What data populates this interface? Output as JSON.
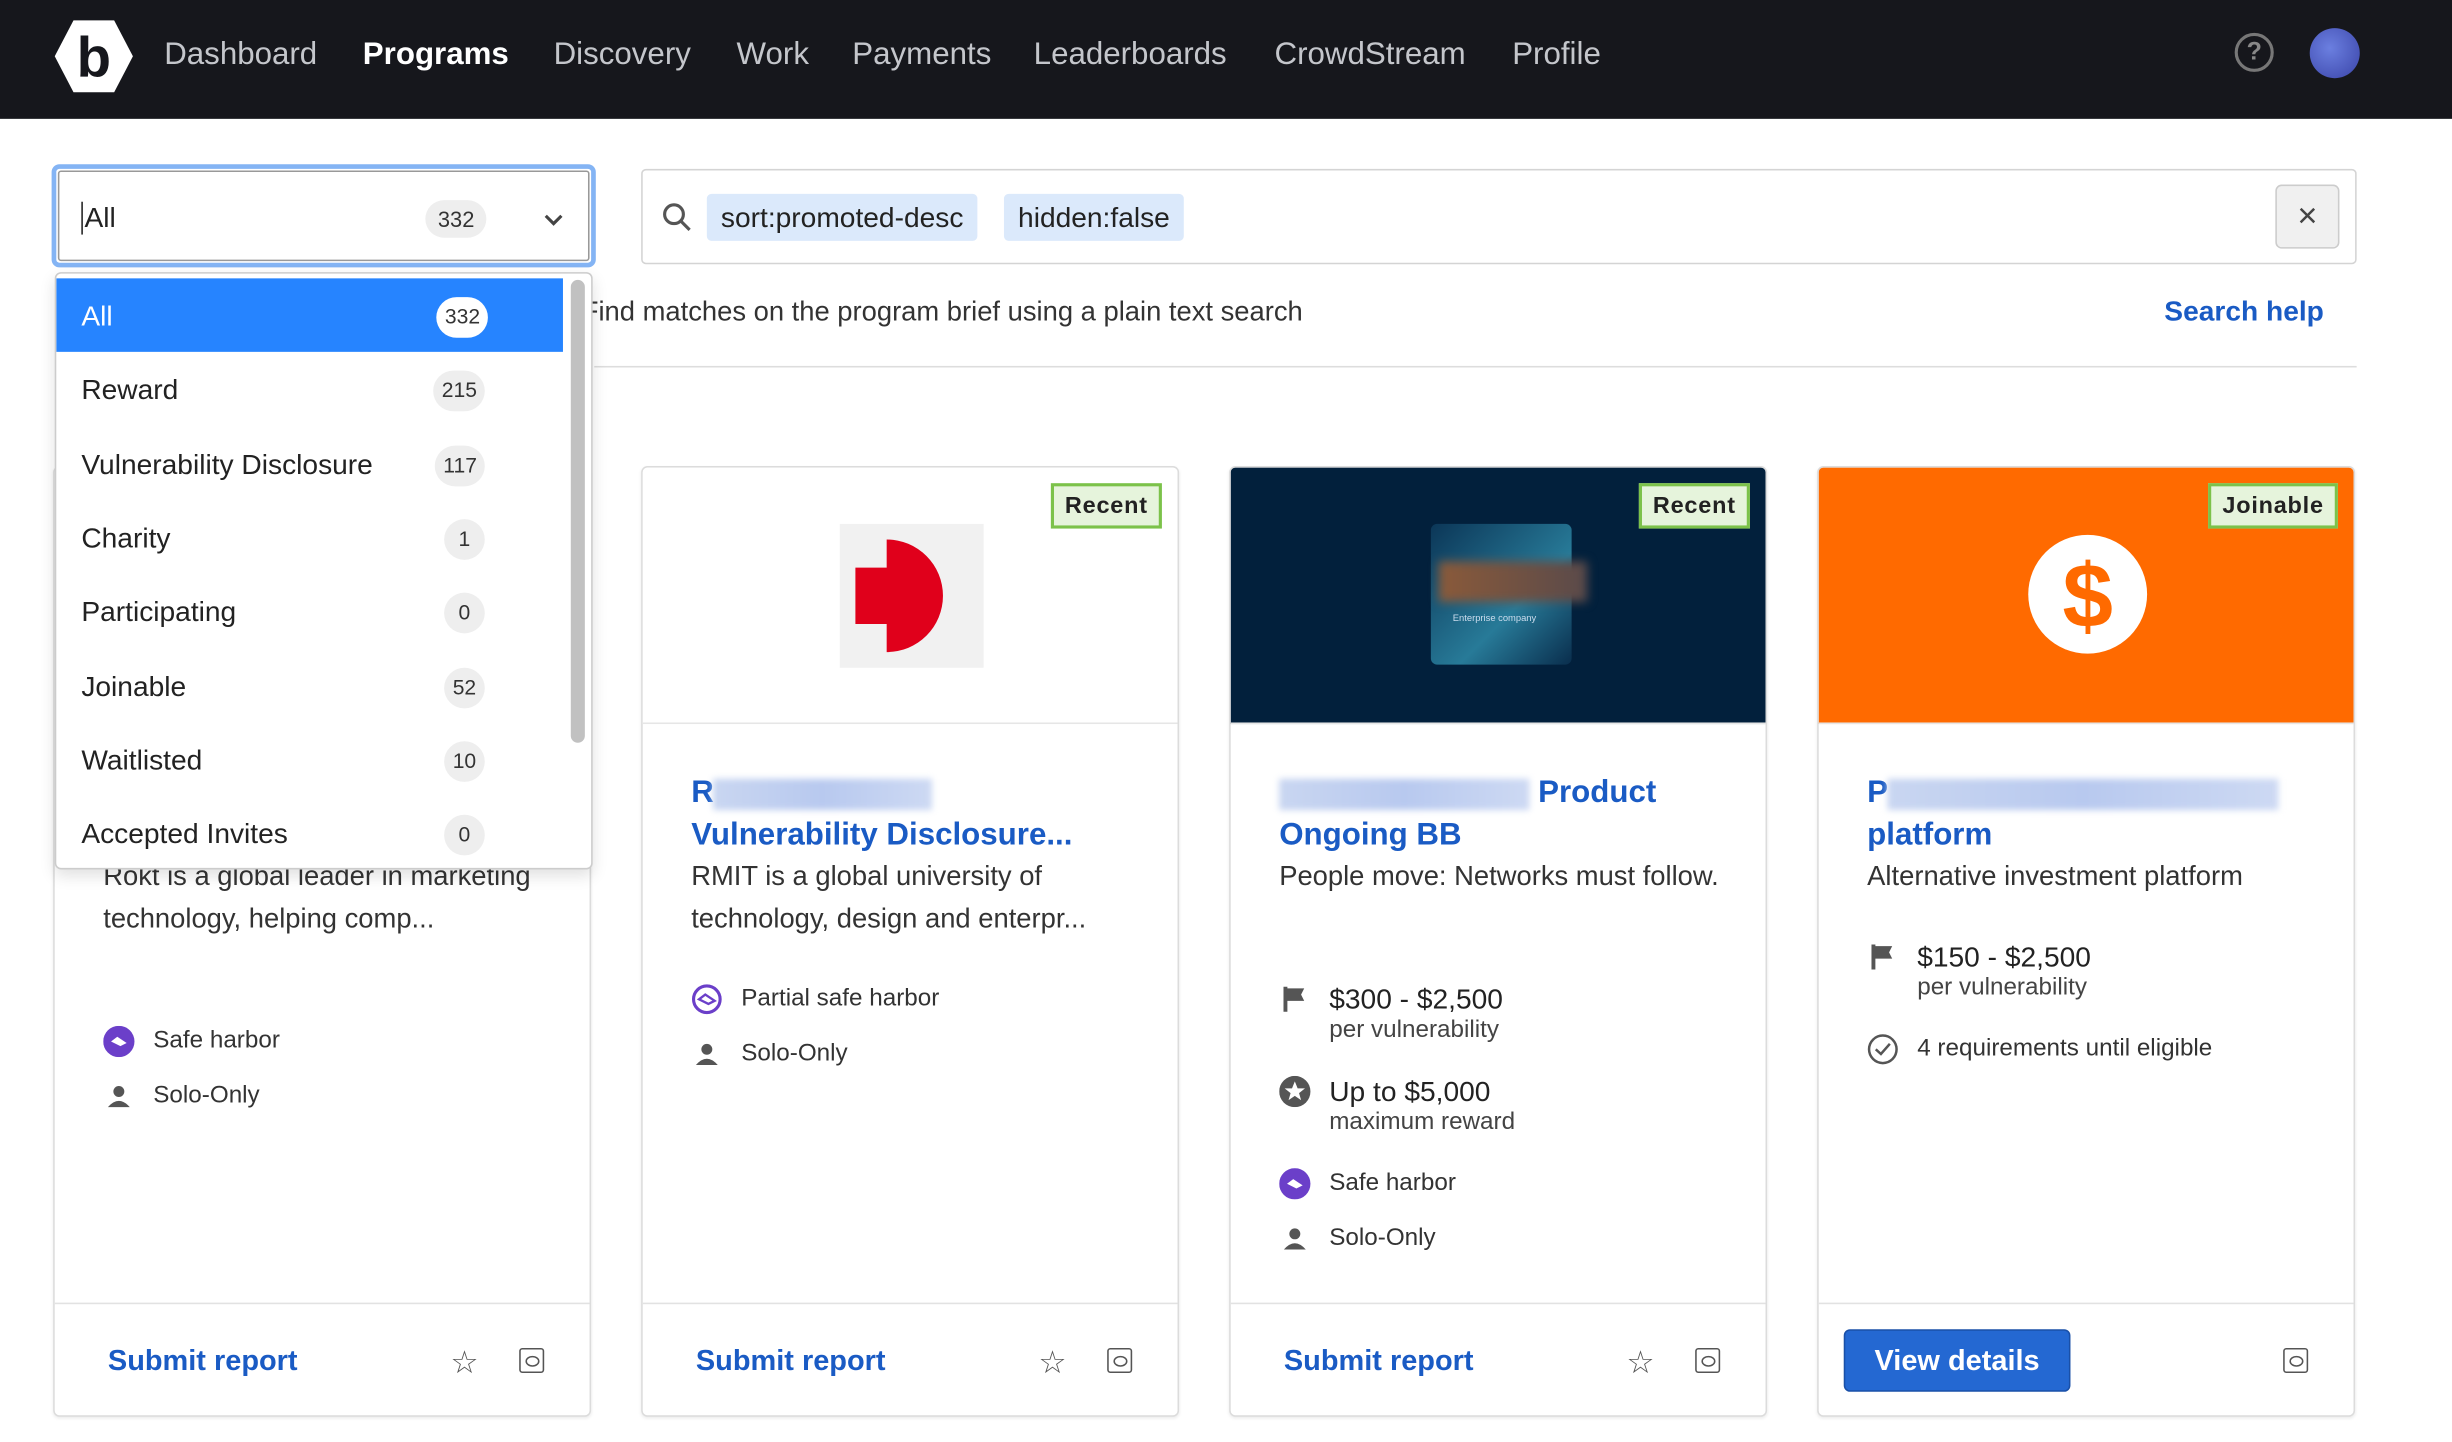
{
  "nav": {
    "items": [
      "Dashboard",
      "Programs",
      "Discovery",
      "Work",
      "Payments",
      "Leaderboards",
      "CrowdStream",
      "Profile"
    ],
    "active": "Programs",
    "logo_letter": "b"
  },
  "filter": {
    "value": "All",
    "count": "332"
  },
  "filter_options": [
    {
      "label": "All",
      "count": "332",
      "selected": true
    },
    {
      "label": "Reward",
      "count": "215"
    },
    {
      "label": "Vulnerability Disclosure",
      "count": "117"
    },
    {
      "label": "Charity",
      "count": "1"
    },
    {
      "label": "Participating",
      "count": "0"
    },
    {
      "label": "Joinable",
      "count": "52"
    },
    {
      "label": "Waitlisted",
      "count": "10"
    },
    {
      "label": "Accepted Invites",
      "count": "0"
    }
  ],
  "search": {
    "chips": [
      "sort:promoted-desc",
      "hidden:false"
    ],
    "clear": "×",
    "helper": "Find matches on the program brief using a plain text search",
    "help_link": "Search help"
  },
  "colors": {
    "nav_bg": "#16171c",
    "accent": "#1a5bc4",
    "selected": "#2684ff",
    "card3_bg": "#02203c",
    "card4_bg": "#ff6a00"
  },
  "cards": [
    {
      "desc": "Rokt is a global leader in marketing technology, helping comp...",
      "meta": [
        "Safe harbor",
        "Solo-Only"
      ],
      "footer": "Submit report"
    },
    {
      "tag": "Recent",
      "title_start": "R",
      "title_line2": "Vulnerability Disclosure...",
      "desc": "RMIT is a global university of technology, design and enterpr...",
      "meta": [
        "Partial safe harbor",
        "Solo-Only"
      ],
      "footer": "Submit report"
    },
    {
      "tag": "Recent",
      "image_caption": "Enterprise company",
      "title_end": "Product",
      "title_line2": "Ongoing BB",
      "desc": "People move: Networks must follow.",
      "reward": "$300 - $2,500",
      "reward_sub": "per vulnerability",
      "max": "Up to $5,000",
      "max_sub": "maximum reward",
      "meta": [
        "Safe harbor",
        "Solo-Only"
      ],
      "footer": "Submit report"
    },
    {
      "tag": "Joinable",
      "title_start": "P",
      "title_line2": "platform",
      "desc": "Alternative investment platform",
      "reward": "$150 - $2,500",
      "reward_sub": "per vulnerability",
      "requirements": "4 requirements until eligible",
      "footer": "View details"
    }
  ]
}
